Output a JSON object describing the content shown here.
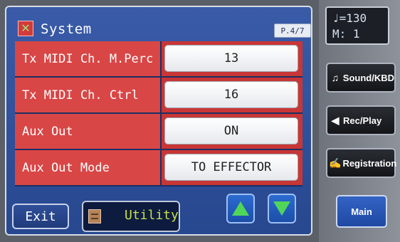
{
  "header": {
    "title": "System",
    "page": "P.4/7",
    "app_icon": "tools-icon"
  },
  "rows": [
    {
      "label": "Tx MIDI Ch. M.Perc",
      "value": "13"
    },
    {
      "label": "Tx MIDI Ch. Ctrl",
      "value": "16"
    },
    {
      "label": "Aux Out",
      "value": "ON"
    },
    {
      "label": "Aux Out Mode",
      "value": "TO EFFECTOR"
    }
  ],
  "footer": {
    "exit_label": "Exit",
    "utility_label": "Utility"
  },
  "tempo": {
    "line1": "♩=130",
    "line2": "M:  1"
  },
  "side_buttons": [
    {
      "label": "Sound/KBD",
      "icon": "music-note-icon"
    },
    {
      "label": "Rec/Play",
      "icon": "speaker-icon"
    },
    {
      "label": "Registration",
      "icon": "registration-icon"
    }
  ],
  "main_label": "Main",
  "colors": {
    "panel": "#27478f",
    "label_cell": "#d94646",
    "arrow": "#4fd65a",
    "utility_text": "#c6e04a"
  }
}
